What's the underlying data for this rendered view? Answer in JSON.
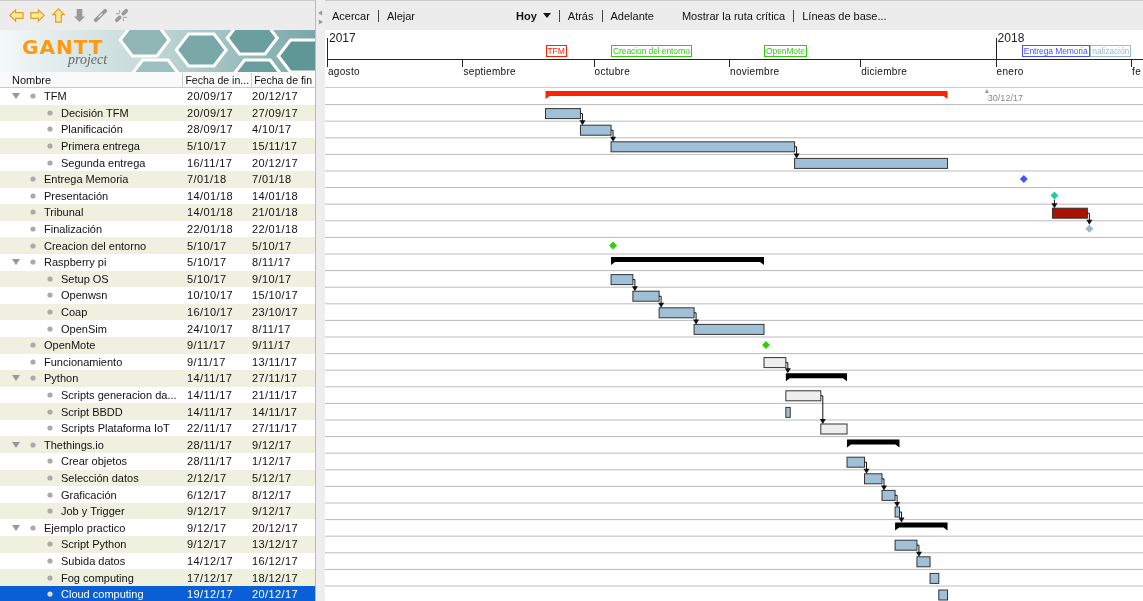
{
  "logo": {
    "title": "GANTT",
    "subtitle": "project"
  },
  "columns": [
    "Nombre",
    "Fecha de in...",
    "Fecha de fin"
  ],
  "tasks": [
    {
      "name": "TFM",
      "start": "20/09/17",
      "end": "20/12/17",
      "kind": "summary",
      "color": "#ff2200",
      "timeline_label": {
        "text": "TFM",
        "color": "#ff2200"
      },
      "expanded": true,
      "selected": false,
      "linked": false,
      "children": [
        {
          "name": "Decisión TFM",
          "start": "20/09/17",
          "end": "27/09/17",
          "kind": "task",
          "color": "#a0c0d8",
          "selected": false,
          "linked": true
        },
        {
          "name": "Planificación",
          "start": "28/09/17",
          "end": "4/10/17",
          "kind": "task",
          "color": "#a0c0d8",
          "selected": false,
          "linked": true
        },
        {
          "name": "Primera entrega",
          "start": "5/10/17",
          "end": "15/11/17",
          "kind": "task",
          "color": "#a0c0d8",
          "selected": false,
          "linked": true
        },
        {
          "name": "Segunda entrega",
          "start": "16/11/17",
          "end": "20/12/17",
          "kind": "task",
          "color": "#a0c0d8",
          "selected": false,
          "linked": false
        }
      ]
    },
    {
      "name": "Entrega Memoria",
      "start": "7/01/18",
      "end": "7/01/18",
      "kind": "milestone",
      "color": "#4455ff",
      "timeline_label": {
        "text": "Entrega Memoria",
        "color": "#4455ff"
      },
      "selected": false,
      "linked": false
    },
    {
      "name": "Presentación",
      "start": "14/01/18",
      "end": "14/01/18",
      "kind": "milestone",
      "color": "#22ccaa",
      "selected": false,
      "linked": true
    },
    {
      "name": "Tribunal",
      "start": "14/01/18",
      "end": "21/01/18",
      "kind": "task",
      "color": "#aa1100",
      "selected": false,
      "linked": true
    },
    {
      "name": "Finalización",
      "start": "22/01/18",
      "end": "22/01/18",
      "kind": "milestone",
      "color": "#99bbcc",
      "timeline_label": {
        "text": "nalización",
        "color": "#99bbdd"
      },
      "selected": false,
      "linked": false
    },
    {
      "name": "Creacion del entorno",
      "start": "5/10/17",
      "end": "5/10/17",
      "kind": "milestone",
      "color": "#33cc11",
      "timeline_label": {
        "text": "Creacion del entorno",
        "color": "#33cc11"
      },
      "selected": false,
      "linked": false
    },
    {
      "name": "Raspberry pi",
      "start": "5/10/17",
      "end": "8/11/17",
      "kind": "summary",
      "color": "#000000",
      "expanded": true,
      "selected": false,
      "linked": false,
      "children": [
        {
          "name": "Setup OS",
          "start": "5/10/17",
          "end": "9/10/17",
          "kind": "task",
          "color": "#a0c0d8",
          "selected": false,
          "linked": true
        },
        {
          "name": "Openwsn",
          "start": "10/10/17",
          "end": "15/10/17",
          "kind": "task",
          "color": "#a0c0d8",
          "selected": false,
          "linked": true
        },
        {
          "name": "Coap",
          "start": "16/10/17",
          "end": "23/10/17",
          "kind": "task",
          "color": "#a0c0d8",
          "selected": false,
          "linked": true
        },
        {
          "name": "OpenSim",
          "start": "24/10/17",
          "end": "8/11/17",
          "kind": "task",
          "color": "#a0c0d8",
          "selected": false,
          "linked": false
        }
      ]
    },
    {
      "name": "OpenMote",
      "start": "9/11/17",
      "end": "9/11/17",
      "kind": "milestone",
      "color": "#33cc11",
      "timeline_label": {
        "text": "OpenMote",
        "color": "#33cc11"
      },
      "selected": false,
      "linked": false
    },
    {
      "name": "Funcionamiento",
      "start": "9/11/17",
      "end": "13/11/17",
      "kind": "task",
      "color": "#eeeeee",
      "selected": false,
      "linked": true
    },
    {
      "name": "Python",
      "start": "14/11/17",
      "end": "27/11/17",
      "kind": "summary",
      "color": "#000000",
      "expanded": true,
      "selected": false,
      "linked": false,
      "children": [
        {
          "name": "Scripts generacion da...",
          "start": "14/11/17",
          "end": "21/11/17",
          "kind": "task",
          "color": "#eeeeee",
          "selected": false,
          "linked": true
        },
        {
          "name": "Script BBDD",
          "start": "14/11/17",
          "end": "14/11/17",
          "kind": "task",
          "color": "#a0c0d8",
          "selected": false,
          "linked": false
        },
        {
          "name": "Scripts Plataforma IoT",
          "start": "22/11/17",
          "end": "27/11/17",
          "kind": "task",
          "color": "#eeeeee",
          "selected": false,
          "linked": false
        }
      ]
    },
    {
      "name": "Thethings.io",
      "start": "28/11/17",
      "end": "9/12/17",
      "kind": "summary",
      "color": "#000000",
      "expanded": true,
      "selected": false,
      "linked": false,
      "children": [
        {
          "name": "Crear objetos",
          "start": "28/11/17",
          "end": "1/12/17",
          "kind": "task",
          "color": "#a0c0d8",
          "selected": false,
          "linked": true
        },
        {
          "name": "Selección datos",
          "start": "2/12/17",
          "end": "5/12/17",
          "kind": "task",
          "color": "#a0c0d8",
          "selected": false,
          "linked": true
        },
        {
          "name": "Graficación",
          "start": "6/12/17",
          "end": "8/12/17",
          "kind": "task",
          "color": "#a0c0d8",
          "selected": false,
          "linked": true
        },
        {
          "name": "Job y Trigger",
          "start": "9/12/17",
          "end": "9/12/17",
          "kind": "task",
          "color": "#a0c0d8",
          "selected": false,
          "linked": true
        }
      ]
    },
    {
      "name": "Ejemplo practico",
      "start": "9/12/17",
      "end": "20/12/17",
      "kind": "summary",
      "color": "#000000",
      "expanded": true,
      "selected": false,
      "linked": false,
      "children": [
        {
          "name": "Script Python",
          "start": "9/12/17",
          "end": "13/12/17",
          "kind": "task",
          "color": "#a0c0d8",
          "selected": false,
          "linked": true
        },
        {
          "name": "Subida datos",
          "start": "14/12/17",
          "end": "16/12/17",
          "kind": "task",
          "color": "#a0c0d8",
          "selected": false,
          "linked": false
        },
        {
          "name": "Fog computing",
          "start": "17/12/17",
          "end": "18/12/17",
          "kind": "task",
          "color": "#a0c0d8",
          "selected": false,
          "linked": false
        },
        {
          "name": "Cloud computing",
          "start": "19/12/17",
          "end": "20/12/17",
          "kind": "task",
          "color": "#a0c0d8",
          "selected": true,
          "linked": false
        }
      ]
    }
  ],
  "chart_toolbar": [
    [
      {
        "label": "Acercar",
        "kind": "button"
      },
      {
        "label": "Alejar",
        "kind": "button"
      }
    ],
    [
      {
        "label": "Hoy",
        "kind": "dropdown"
      },
      {
        "label": "Atrás",
        "kind": "button"
      },
      {
        "label": "Adelante",
        "kind": "button"
      }
    ],
    [
      {
        "label": "Mostrar la ruta crítica",
        "kind": "button"
      },
      {
        "label": "Líneas de base...",
        "kind": "button"
      }
    ]
  ],
  "timeline": {
    "months": [
      {
        "label": "agosto",
        "year": "2017"
      },
      {
        "label": "septiembre"
      },
      {
        "label": "octubre"
      },
      {
        "label": "noviembre"
      },
      {
        "label": "diciembre"
      },
      {
        "label": "enero",
        "year": "2018"
      },
      {
        "label": "fe"
      }
    ],
    "today": "30/12/17"
  }
}
